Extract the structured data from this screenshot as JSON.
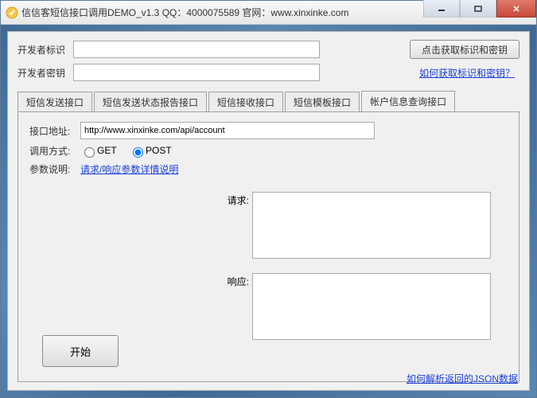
{
  "window": {
    "title": "信信客短信接口调用DEMO_v1.3 QQ：4000075589  官网：www.xinxinke.com"
  },
  "controls": {
    "minimize": "–",
    "maximize": "☐",
    "close": "✕"
  },
  "form": {
    "dev_id_label": "开发者标识",
    "dev_id_value": "",
    "dev_key_label": "开发者密钥",
    "dev_key_value": "",
    "fetch_button": "点击获取标识和密钥",
    "help_link": "如何获取标识和密钥？"
  },
  "tabs": [
    "短信发送接口",
    "短信发送状态报告接口",
    "短信接收接口",
    "短信模板接口",
    "帐户信息查询接口"
  ],
  "active_tab_index": 4,
  "panel": {
    "api_url_label": "接口地址:",
    "api_url_value": "http://www.xinxinke.com/api/account",
    "method_label": "调用方式:",
    "method_options": [
      "GET",
      "POST"
    ],
    "method_selected": "POST",
    "param_label": "参数说明:",
    "param_link": "请求/响应参数详情说明",
    "request_label": "请求:",
    "request_value": "",
    "response_label": "响应:",
    "response_value": "",
    "start_button": "开始"
  },
  "footer": {
    "json_parse_link": "如何解析返回的JSON数据"
  }
}
